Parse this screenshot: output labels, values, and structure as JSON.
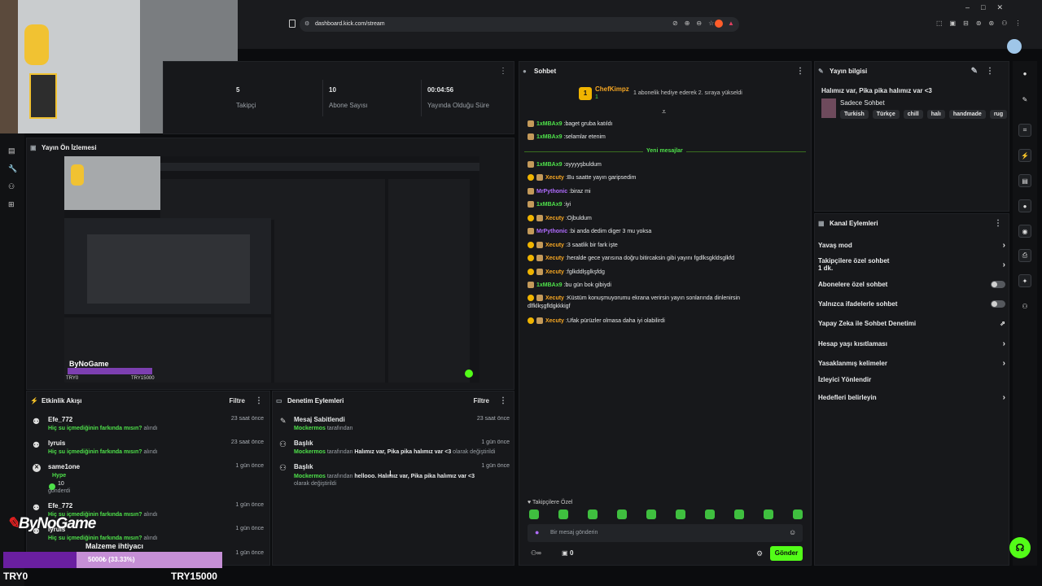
{
  "browser": {
    "url": "dashboard.kick.com/stream"
  },
  "stats": [
    {
      "value": "5",
      "label": "Takipçi"
    },
    {
      "value": "10",
      "label": "Abone Sayısı"
    },
    {
      "value": "00:04:56",
      "label": "Yayında Olduğu Süre"
    }
  ],
  "preview": {
    "title": "Yayın Ön İzlemesi"
  },
  "activity": {
    "title": "Etkinlik Akışı",
    "filter": "Filtre",
    "items": [
      {
        "name": "Efe_772",
        "text": "Hiç su içmediğinin farkında mısın?",
        "suffix": "alındı",
        "time": "23 saat önce"
      },
      {
        "name": "lyruis",
        "text": "Hiç su içmediğinin farkında mısın?",
        "suffix": "alındı",
        "time": "23 saat önce"
      },
      {
        "name": "same1one",
        "text": "Hype",
        "count": "10",
        "suffix": "gönderdi",
        "time": "1 gün önce"
      },
      {
        "name": "Efe_772",
        "text": "Hiç su içmediğinin farkında mısın?",
        "suffix": "alındı",
        "time": "1 gün önce"
      },
      {
        "name": "lyruis",
        "text": "Hiç su içmediğinin farkında mısın?",
        "suffix": "alındı",
        "time": "1 gün önce"
      },
      {
        "name": "",
        "text": "",
        "suffix": "",
        "time": "1 gün önce"
      }
    ]
  },
  "moderation": {
    "title": "Denetim Eylemleri",
    "filter": "Filtre",
    "items": [
      {
        "title": "Mesaj Sabitlendi",
        "user": "Mockermos",
        "by": "tarafından",
        "time": "23 saat önce"
      },
      {
        "title": "Başlık",
        "user": "Mockermos",
        "by": "tarafından",
        "value": "Halımız var, Pika pika halımız var <3",
        "suffix": "olarak değiştirildi",
        "time": "1 gün önce"
      },
      {
        "title": "Başlık",
        "user": "Mockermos",
        "by": "tarafından",
        "value_a": "hellooo.",
        "value": "Halımız var, Pika pika halımız var <3",
        "suffix": "olarak değiştirildi",
        "time": "1 gün önce"
      }
    ]
  },
  "chat": {
    "title": "Sohbet",
    "pinned_user": "ChefKimpz",
    "pinned_count": "1",
    "pinned_text": "1 abonelik hediye ederek 2. sıraya yükseldi",
    "new_messages": "Yeni mesajlar",
    "messages": [
      {
        "user": "1xMBAx9",
        "color": "#4ee04a",
        "text": "baget gruba katıldı",
        "badges": 1
      },
      {
        "user": "1xMBAx9",
        "color": "#4ee04a",
        "text": "selamlar etenim",
        "badges": 1
      },
      {
        "user": "1xMBAx9",
        "color": "#4ee04a",
        "text": "oyyyyşbuldum",
        "badges": 1
      },
      {
        "user": "Xecuty",
        "color": "#f5a623",
        "text": "Bu saatte yayın garipsedim",
        "badges": 2
      },
      {
        "user": "MrPythonic",
        "color": "#b06cff",
        "text": "biraz mi",
        "badges": 1
      },
      {
        "user": "1xMBAx9",
        "color": "#4ee04a",
        "text": "iyi",
        "badges": 1
      },
      {
        "user": "Xecuty",
        "color": "#f5a623",
        "text": "Ojbuldum",
        "badges": 2
      },
      {
        "user": "MrPythonic",
        "color": "#b06cff",
        "text": "bi anda dedim diger 3 mu yoksa",
        "badges": 1
      },
      {
        "user": "Xecuty",
        "color": "#f5a623",
        "text": "3 saatlik bir fark işte",
        "badges": 2
      },
      {
        "user": "Xecuty",
        "color": "#f5a623",
        "text": "heralde gece yarısına doğru bitircaksin gibi yayını fgdlksgkldsglkfd",
        "badges": 2
      },
      {
        "user": "Xecuty",
        "color": "#f5a623",
        "text": "fglkddlşglkşfdg",
        "badges": 2
      },
      {
        "user": "1xMBAx9",
        "color": "#4ee04a",
        "text": "bu gün bok gibiydi",
        "badges": 1
      },
      {
        "user": "Xecuty",
        "color": "#f5a623",
        "text": "Küstüm konuşmuyorumu ekrana verirsin yayın sonlarında dinlenirsin",
        "text2": "dlfklkşgfldgkkkigf",
        "badges": 2
      },
      {
        "user": "Xecuty",
        "color": "#f5a623",
        "text": "Ufak pürüzler olmasa daha iyi olabilirdi",
        "badges": 2
      }
    ],
    "followers_only": "Takipçilere Özel",
    "placeholder": "Bir mesaj gönderin",
    "viewer_count": "0",
    "send": "Gönder"
  },
  "stream_info": {
    "title": "Yayın bilgisi",
    "stream_title": "Halımız var, Pika pika halımız var <3",
    "category": "Sadece Sohbet",
    "tags": [
      "Turkish",
      "Türkçe",
      "chill",
      "halı",
      "handmade",
      "rug"
    ]
  },
  "channel_actions": {
    "title": "Kanal Eylemleri",
    "items": [
      {
        "label": "Yavaş mod",
        "control": "chevron"
      },
      {
        "label": "Takipçilere özel sohbet",
        "sub": "1 dk.",
        "control": "chevron"
      },
      {
        "label": "Abonelere özel sohbet",
        "control": "toggle"
      },
      {
        "label": "Yalnızca ifadelerle sohbet",
        "control": "toggle"
      },
      {
        "label": "Yapay Zeka ile Sohbet Denetimi",
        "control": "external"
      },
      {
        "label": "Hesap yaşı kısıtlaması",
        "control": "chevron"
      },
      {
        "label": "Yasaklanmış kelimeler",
        "control": "chevron"
      },
      {
        "label": "İzleyici Yönlendir",
        "control": "none"
      },
      {
        "label": "Hedefleri belirleyin",
        "control": "chevron"
      }
    ]
  },
  "overlay": {
    "logo": "ByNoGame",
    "goal_title": "Malzeme ihtiyacı",
    "goal_progress_text": "5000₺ (33.33%)",
    "goal_progress": 0.3333,
    "goal_min": "TRY0",
    "goal_max": "TRY15000"
  },
  "colors": {
    "kick_green": "#53fc18",
    "panel_bg": "#17181b",
    "page_bg": "#0b0c0e"
  }
}
